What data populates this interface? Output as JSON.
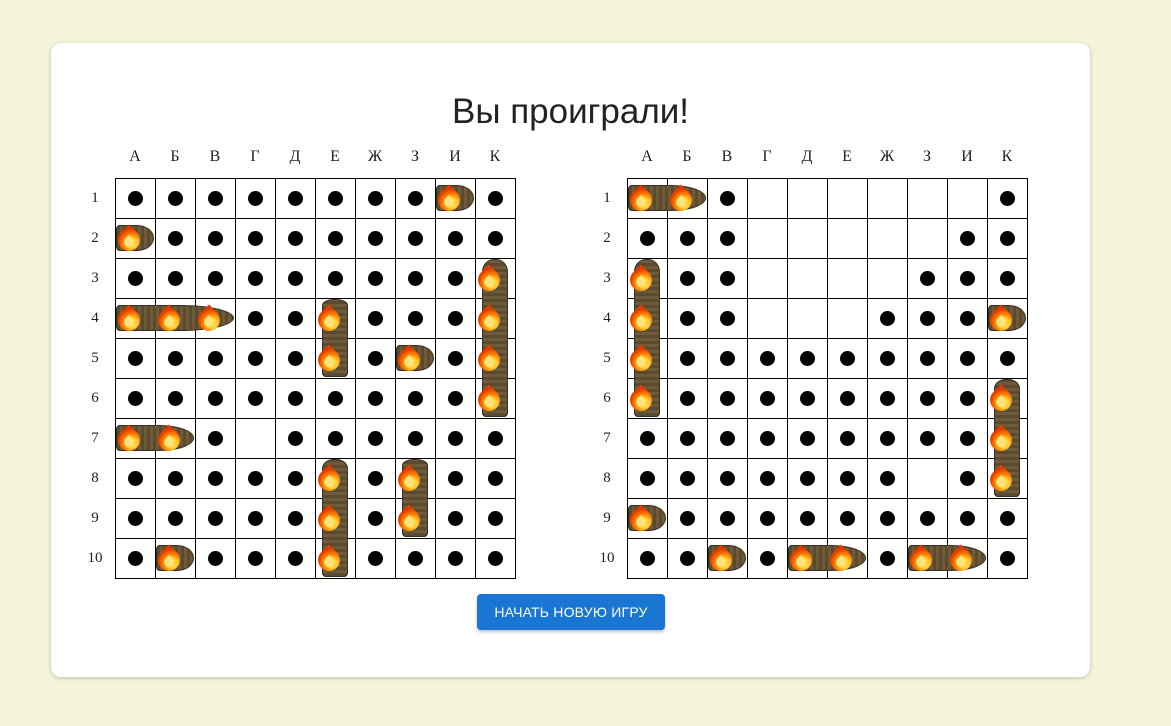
{
  "title": "Вы проиграли!",
  "button_label": "НАЧАТЬ НОВУЮ ИГРУ",
  "columns": [
    "А",
    "Б",
    "В",
    "Г",
    "Д",
    "Е",
    "Ж",
    "З",
    "И",
    "К"
  ],
  "rows": [
    "1",
    "2",
    "3",
    "4",
    "5",
    "6",
    "7",
    "8",
    "9",
    "10"
  ],
  "colors": {
    "background": "#f4f4dc",
    "button": "#1976d2"
  },
  "boards": [
    {
      "id": "player-board",
      "cells": [
        "........H.",
        "H.........",
        ".........H",
        "HHH..H...H",
        ".....H.H.H",
        ".........H",
        "HH.-......",
        ".....H.H..",
        ".....H.H..",
        ".H...H...."
      ],
      "ships": [
        {
          "row": 0,
          "col": 8,
          "len": 1,
          "dir": "h"
        },
        {
          "row": 1,
          "col": 0,
          "len": 1,
          "dir": "h"
        },
        {
          "row": 2,
          "col": 9,
          "len": 4,
          "dir": "v"
        },
        {
          "row": 3,
          "col": 0,
          "len": 3,
          "dir": "h"
        },
        {
          "row": 3,
          "col": 5,
          "len": 2,
          "dir": "v"
        },
        {
          "row": 4,
          "col": 7,
          "len": 1,
          "dir": "h"
        },
        {
          "row": 6,
          "col": 0,
          "len": 2,
          "dir": "h"
        },
        {
          "row": 7,
          "col": 5,
          "len": 3,
          "dir": "v"
        },
        {
          "row": 7,
          "col": 7,
          "len": 2,
          "dir": "v"
        },
        {
          "row": 9,
          "col": 1,
          "len": 1,
          "dir": "h"
        }
      ]
    },
    {
      "id": "enemy-board",
      "cells": [
        "HH.------.",
        "...-----..",
        "H..----...",
        "H..---...H",
        "H.........",
        "H........H",
        ".........H",
        ".......-.H",
        "H.........",
        "..H.HH.HH."
      ],
      "ships": [
        {
          "row": 0,
          "col": 0,
          "len": 2,
          "dir": "h"
        },
        {
          "row": 2,
          "col": 0,
          "len": 4,
          "dir": "v"
        },
        {
          "row": 3,
          "col": 9,
          "len": 1,
          "dir": "h"
        },
        {
          "row": 5,
          "col": 9,
          "len": 3,
          "dir": "v"
        },
        {
          "row": 8,
          "col": 0,
          "len": 1,
          "dir": "h"
        },
        {
          "row": 9,
          "col": 2,
          "len": 1,
          "dir": "h"
        },
        {
          "row": 9,
          "col": 4,
          "len": 2,
          "dir": "h"
        },
        {
          "row": 9,
          "col": 7,
          "len": 2,
          "dir": "h"
        }
      ]
    }
  ]
}
